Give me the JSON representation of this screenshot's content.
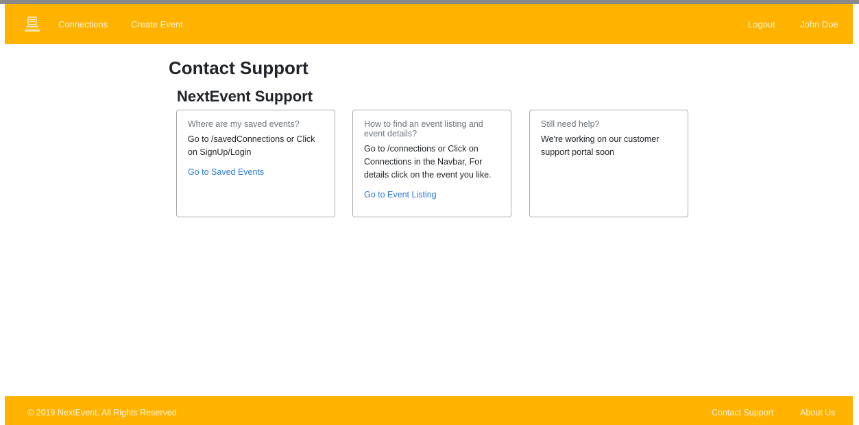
{
  "navbar": {
    "logo_icon": "nextevent-logo-icon",
    "links": [
      "Connections",
      "Create Event"
    ],
    "logout_label": "Logout",
    "user_name": "John Doe"
  },
  "page": {
    "title": "Contact Support",
    "section_title": "NextEvent Support"
  },
  "cards": [
    {
      "title": "Where are my saved events?",
      "text": "Go to /savedConnections or Click on SignUp/Login",
      "link": "Go to Saved Events"
    },
    {
      "title": "How to find an event listing and event details?",
      "text": "Go to /connections or Click on Connections in the Navbar, For details click on the event you like.",
      "link": "Go to Event Listing"
    },
    {
      "title": "Still need help?",
      "text": "We're working on our customer support portal soon"
    }
  ],
  "footer": {
    "copyright": "© 2019 NextEvent. All Rights Reserved",
    "links": [
      "Contact Support",
      "About Us"
    ]
  },
  "colors": {
    "brand": "#FFB300",
    "link": "#2a7bd3"
  }
}
